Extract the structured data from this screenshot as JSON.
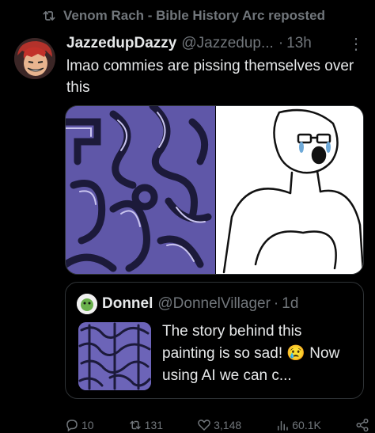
{
  "repost": {
    "label": "Venom Rach - Bible History Arc reposted",
    "icon": "repost-icon"
  },
  "tweet": {
    "display_name": "JazzedupDazzy",
    "handle": "@Jazzedup...",
    "separator": "·",
    "time": "13h",
    "more_label": "⋮",
    "text": "lmao commies are pissing themselves over this"
  },
  "quote": {
    "display_name": "Donnel",
    "handle": "@DonnelVillager",
    "separator": "·",
    "time": "1d",
    "text": "The story behind this painting is so sad! 😢 Now using AI we can c..."
  },
  "actions": {
    "replies": "10",
    "reposts": "131",
    "likes": "3,148",
    "views": "60.1K"
  },
  "colors": {
    "background": "#000000",
    "text": "#e7e9ea",
    "muted": "#71767b",
    "border": "#2f3336",
    "painting": "#5f57a8"
  }
}
